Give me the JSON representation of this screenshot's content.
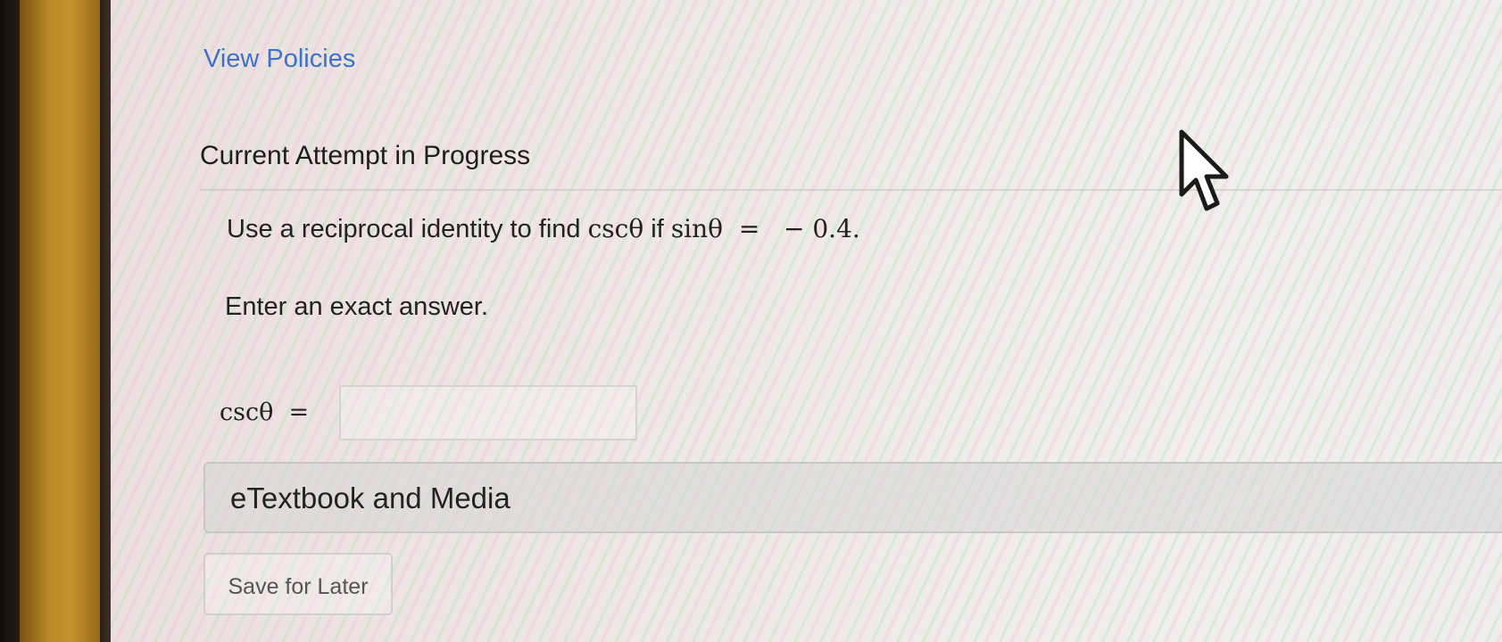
{
  "links": {
    "view_policies": "View Policies"
  },
  "attempt": {
    "heading": "Current Attempt in Progress"
  },
  "question": {
    "prefix": "Use a reciprocal identity to find ",
    "target_expr": "cscθ",
    "middle": " if ",
    "given_expr": "sinθ  =   − 0.4."
  },
  "instruction": "Enter an exact answer.",
  "answer": {
    "label": "cscθ  =",
    "value": "",
    "placeholder": ""
  },
  "media": {
    "label": "eTextbook and Media"
  },
  "buttons": {
    "save_later": "Save for Later"
  },
  "icons": {
    "pointer": "mouse-pointer-icon"
  }
}
